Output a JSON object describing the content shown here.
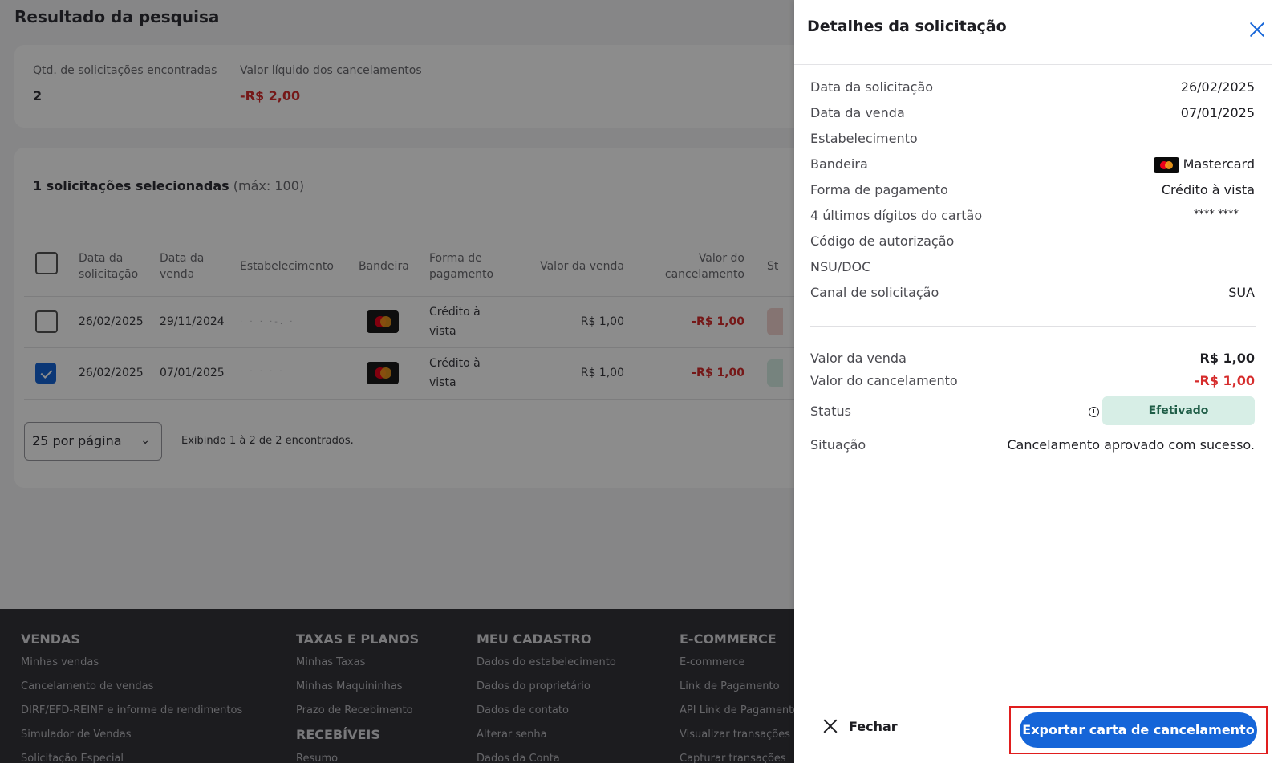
{
  "page": {
    "title": "Resultado da pesquisa",
    "summary": {
      "count_label": "Qtd. de solicitações encontradas",
      "count_value": "2",
      "net_label": "Valor líquido dos cancelamentos",
      "net_value": "-R$ 2,00"
    },
    "selection": {
      "bold_text": "1 solicitações selecionadas",
      "max_text": "(máx: 100)"
    },
    "table": {
      "headers": [
        "Data da solicitação",
        "Data da venda",
        "Estabelecimento",
        "Bandeira",
        "Forma de pagamento",
        "Valor da venda",
        "Valor do cancelamento",
        "St"
      ],
      "rows": [
        {
          "checked": false,
          "request_date": "26/02/2025",
          "sale_date": "29/11/2024",
          "establishment": "· · · ·-. ·",
          "brand": "Mastercard",
          "payment_l1": "Crédito à",
          "payment_l2": "vista",
          "sale_value": "R$  1,00",
          "cancel_value": "-R$  1,00",
          "status_color": "#f3d4d0"
        },
        {
          "checked": true,
          "request_date": "26/02/2025",
          "sale_date": "07/01/2025",
          "establishment": "· · · · ·",
          "brand": "Mastercard",
          "payment_l1": "Crédito à",
          "payment_l2": "vista",
          "sale_value": "R$  1,00",
          "cancel_value": "-R$  1,00",
          "status_color": "#d7eee6"
        }
      ]
    },
    "pagination": {
      "per_page": "25 por página",
      "showing": "Exibindo 1 à 2 de 2 encontrados."
    }
  },
  "footer": {
    "vendas": {
      "title": "VENDAS",
      "links": [
        "Minhas vendas",
        "Cancelamento de vendas",
        "DIRF/EFD-REINF e informe de rendimentos",
        "Simulador de Vendas",
        "Solicitação Especial"
      ]
    },
    "taxas": {
      "title": "TAXAS E PLANOS",
      "links": [
        "Minhas Taxas",
        "Minhas Maquininhas",
        "Prazo de Recebimento"
      ],
      "subtitle": "RECEBÍVEIS",
      "sublink": "Resumo"
    },
    "cadastro": {
      "title": "MEU CADASTRO",
      "links": [
        "Dados do estabelecimento",
        "Dados do proprietário",
        "Dados de contato",
        "Alterar senha",
        "Dados da Conta"
      ]
    },
    "ecommerce": {
      "title": "E-COMMERCE",
      "links": [
        "E-commerce",
        "Link de Pagamento",
        "API Link de Pagamento",
        "Visualizar transações",
        "Capturar transações"
      ]
    }
  },
  "drawer": {
    "title": "Detalhes da solicitação",
    "details": [
      {
        "label": "Data da solicitação",
        "value": "26/02/2025"
      },
      {
        "label": "Data da venda",
        "value": "07/01/2025"
      },
      {
        "label": "Estabelecimento",
        "value": ""
      },
      {
        "label": "Bandeira",
        "value": "Mastercard"
      },
      {
        "label": "Forma de pagamento",
        "value": "Crédito à vista"
      },
      {
        "label": "4 últimos dígitos do cartão",
        "value": "**** ****"
      },
      {
        "label": "Código de autorização",
        "value": ""
      },
      {
        "label": "NSU/DOC",
        "value": ""
      },
      {
        "label": "Canal de solicitação",
        "value": "SUA"
      }
    ],
    "sale_value_label": "Valor da venda",
    "sale_value": "R$ 1,00",
    "cancel_value_label": "Valor do cancelamento",
    "cancel_value": "-R$ 1,00",
    "status_label": "Status",
    "status_value": "Efetivado",
    "situation_label": "Situação",
    "situation_value": "Cancelamento aprovado com sucesso.",
    "close_label": "Fechar",
    "export_label": "Exportar carta de cancelamento"
  },
  "icons": {
    "close": "close-icon",
    "info": "info-icon",
    "chevron": "chevron-down-icon",
    "card_brand": "mastercard-icon"
  },
  "colors": {
    "primary": "#1565d8",
    "negative": "#d62c2c",
    "status_success_bg": "#d7eee6",
    "highlight_frame": "#e01e1e"
  }
}
